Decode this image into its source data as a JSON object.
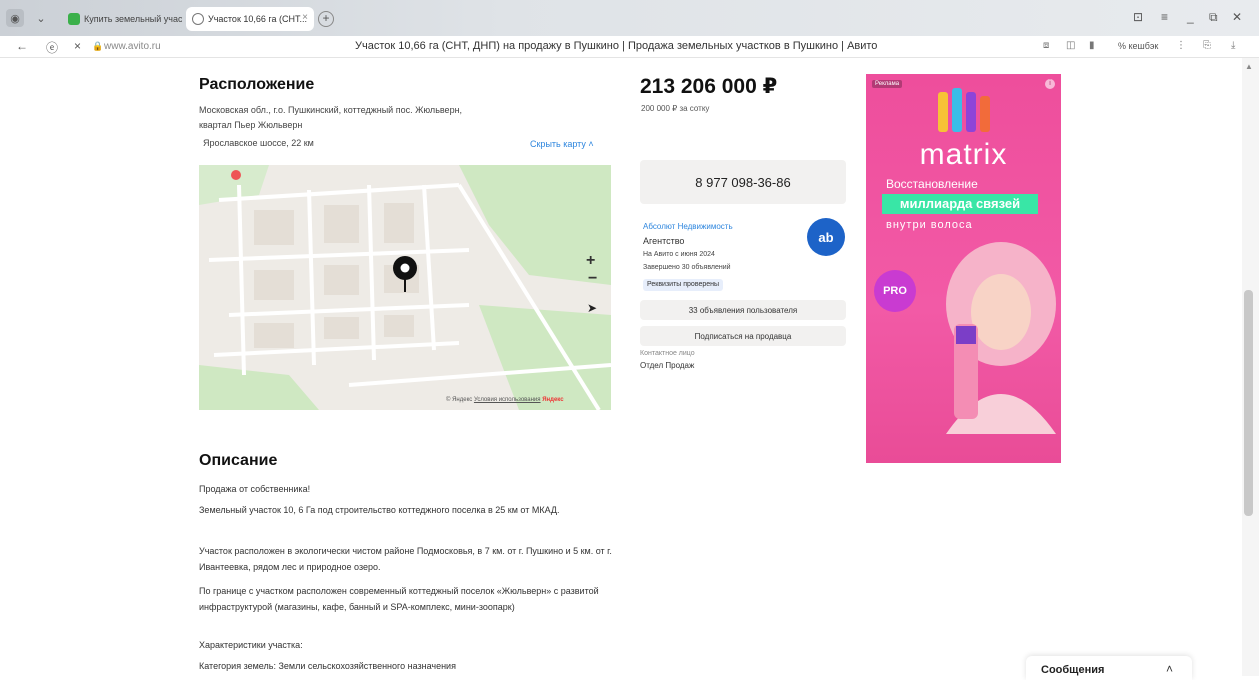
{
  "browser": {
    "tabs": [
      {
        "title": "Купить земельный участ..."
      },
      {
        "title": "Участок 10,66 га (СНТ..."
      }
    ],
    "new_tab": "+",
    "url": "www.avito.ru",
    "page_title": "Участок 10,66 га (СНТ, ДНП) на продажу в Пушкино | Продажа земельных участков в Пушкино | Авито",
    "cashback": "% кешбэк"
  },
  "location": {
    "heading": "Расположение",
    "address_line1": "Московская обл., г.о. Пушкинский, коттеджный пос. Жюльверн,",
    "address_line2": "квартал Пьер Жюльверн",
    "highway": "Ярославское шоссе, 22 км",
    "hide_map": "Скрыть карту ˄",
    "map_copyright": "© Яндекс",
    "map_terms": "Условия использования",
    "map_brand": "Яндекс"
  },
  "listing": {
    "price": "213 206 000 ₽",
    "price_per": "200 000 ₽ за сотку",
    "phone": "8 977 098-36-86",
    "seller_name": "Абсолют Недвижимость",
    "seller_type": "Агентство",
    "seller_since": "На Авито с июня 2024",
    "seller_completed": "Завершено 30 объявлений",
    "verified": "Реквизиты проверены",
    "seller_logo": "ab",
    "ads_button": "33 объявления пользователя",
    "subscribe_button": "Подписаться на продавца",
    "contact_label": "Контактное лицо",
    "contact_value": "Отдел Продаж"
  },
  "ad": {
    "label": "Реклама",
    "info": "i",
    "brand": "matrix",
    "line1": "Восстановление",
    "line2": "миллиарда связей",
    "line3": "внутри волоса",
    "badge": "PRO",
    "accent_color": "#ee4e9c",
    "highlight_color": "#39e6a6"
  },
  "description": {
    "heading": "Описание",
    "paragraphs": [
      "Продажа от собственника!",
      "Земельный участок 10, 6 Га под строительство коттеджного поселка в 25 км от МКАД.",
      "Участок расположен в экологически чистом районе Подмосковья, в 7 км. от г. Пушкино и 5 км. от г. Ивантеевка, рядом лес и природное озеро.",
      "По границе с участком расположен современный коттеджный поселок «Жюльверн» с развитой инфраструктурой (магазины, кафе, банный и SPA-комплекс, мини-зоопарк)",
      "Характеристики участка:",
      "Категория земель: Земли сельскохозяйственного назначения"
    ]
  },
  "messages": {
    "label": "Сообщения",
    "chevron": "˄"
  }
}
